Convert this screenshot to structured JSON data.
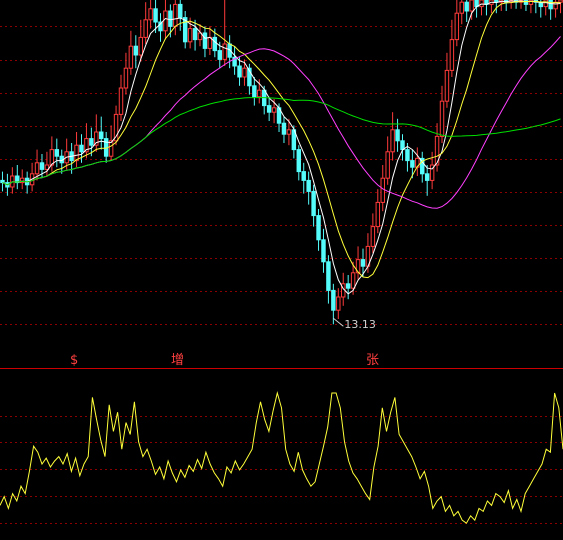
{
  "colors": {
    "background": "#000000",
    "grid": "#8b0000",
    "up_candle": "#ff3b3b",
    "down_candle": "#54fcfc",
    "ma_fast": "#ffffff",
    "ma_mid": "#ffff3a",
    "ma_slow": "#ff40ff",
    "ma_long": "#00e000",
    "indicator": "#ffff3a",
    "divider": "#cc0000",
    "markers": "#ff4040"
  },
  "main": {
    "low_price_label": "13.13",
    "markers": [
      {
        "key": "marker-1",
        "text": "$"
      },
      {
        "key": "marker-2",
        "text": "增"
      },
      {
        "key": "marker-3",
        "text": "张"
      }
    ]
  },
  "chart_data": [
    {
      "type": "candlestick",
      "title": "",
      "ylim": [
        12.5,
        20.5
      ],
      "annotations": [
        "13.13"
      ],
      "candles": [
        [
          16.4,
          16.35,
          16.6,
          16.15
        ],
        [
          16.35,
          16.25,
          16.55,
          16.05
        ],
        [
          16.25,
          16.5,
          16.7,
          16.1
        ],
        [
          16.5,
          16.35,
          16.75,
          16.2
        ],
        [
          16.35,
          16.45,
          16.65,
          16.2
        ],
        [
          16.45,
          16.3,
          16.6,
          16.1
        ],
        [
          16.3,
          16.55,
          16.8,
          16.15
        ],
        [
          16.55,
          16.8,
          17.1,
          16.4
        ],
        [
          16.8,
          16.65,
          17.0,
          16.45
        ],
        [
          16.65,
          16.75,
          17.05,
          16.5
        ],
        [
          16.75,
          17.1,
          17.4,
          16.6
        ],
        [
          17.1,
          16.95,
          17.35,
          16.7
        ],
        [
          16.95,
          16.8,
          17.1,
          16.55
        ],
        [
          16.8,
          17.05,
          17.35,
          16.65
        ],
        [
          17.05,
          16.85,
          17.25,
          16.55
        ],
        [
          16.85,
          17.2,
          17.5,
          16.7
        ],
        [
          17.2,
          17.05,
          17.45,
          16.8
        ],
        [
          17.05,
          17.35,
          17.7,
          16.9
        ],
        [
          17.35,
          17.2,
          17.6,
          16.95
        ],
        [
          17.2,
          17.5,
          17.9,
          17.05
        ],
        [
          17.5,
          17.35,
          17.85,
          17.1
        ],
        [
          17.35,
          16.95,
          17.5,
          16.8
        ],
        [
          16.95,
          17.3,
          17.65,
          16.85
        ],
        [
          17.3,
          17.9,
          18.1,
          17.2
        ],
        [
          17.9,
          18.5,
          18.8,
          17.75
        ],
        [
          18.5,
          18.95,
          19.3,
          18.35
        ],
        [
          18.95,
          19.45,
          19.8,
          18.8
        ],
        [
          19.45,
          19.25,
          19.7,
          18.95
        ],
        [
          19.25,
          19.65,
          20.05,
          19.1
        ],
        [
          19.65,
          20.05,
          20.45,
          19.5
        ],
        [
          20.05,
          20.3,
          20.55,
          19.85
        ],
        [
          20.3,
          20.0,
          20.55,
          19.75
        ],
        [
          20.0,
          19.8,
          20.2,
          19.55
        ],
        [
          19.8,
          20.25,
          20.55,
          19.6
        ],
        [
          20.25,
          19.9,
          20.4,
          19.65
        ],
        [
          19.9,
          20.4,
          20.55,
          19.7
        ],
        [
          20.4,
          20.1,
          20.55,
          19.8
        ],
        [
          20.1,
          19.55,
          20.25,
          19.4
        ],
        [
          19.55,
          19.85,
          20.1,
          19.4
        ],
        [
          19.85,
          19.6,
          20.05,
          19.35
        ],
        [
          19.6,
          19.75,
          19.95,
          19.45
        ],
        [
          19.75,
          19.4,
          19.9,
          19.2
        ],
        [
          19.4,
          19.65,
          19.9,
          19.25
        ],
        [
          19.65,
          19.35,
          19.85,
          19.2
        ],
        [
          19.35,
          19.15,
          19.55,
          18.95
        ],
        [
          19.15,
          19.5,
          20.5,
          19.0
        ],
        [
          19.5,
          19.2,
          19.7,
          18.95
        ],
        [
          19.2,
          19.0,
          19.45,
          18.8
        ],
        [
          19.0,
          18.75,
          19.2,
          18.55
        ],
        [
          18.75,
          18.95,
          19.15,
          18.55
        ],
        [
          18.95,
          18.55,
          19.05,
          18.35
        ],
        [
          18.55,
          18.3,
          18.75,
          18.1
        ],
        [
          18.3,
          18.45,
          18.7,
          18.15
        ],
        [
          18.45,
          18.1,
          18.55,
          17.9
        ],
        [
          18.1,
          17.95,
          18.3,
          17.75
        ],
        [
          17.95,
          18.05,
          18.25,
          17.7
        ],
        [
          18.05,
          17.7,
          18.15,
          17.5
        ],
        [
          17.7,
          17.45,
          17.85,
          17.25
        ],
        [
          17.45,
          17.55,
          17.8,
          17.2
        ],
        [
          17.55,
          17.1,
          17.65,
          16.9
        ],
        [
          17.1,
          16.6,
          17.2,
          16.4
        ],
        [
          16.6,
          16.4,
          16.8,
          16.1
        ],
        [
          16.4,
          16.15,
          16.6,
          15.85
        ],
        [
          16.15,
          15.6,
          16.3,
          15.35
        ],
        [
          15.6,
          15.05,
          15.75,
          14.8
        ],
        [
          15.05,
          14.55,
          15.3,
          14.3
        ],
        [
          14.55,
          13.9,
          14.7,
          13.6
        ],
        [
          13.9,
          13.45,
          14.05,
          13.13
        ],
        [
          13.45,
          13.75,
          13.95,
          13.25
        ],
        [
          13.75,
          14.05,
          14.3,
          13.55
        ],
        [
          14.05,
          13.95,
          14.25,
          13.7
        ],
        [
          13.95,
          14.3,
          14.55,
          13.8
        ],
        [
          14.3,
          14.6,
          14.9,
          14.15
        ],
        [
          14.6,
          14.45,
          14.85,
          14.2
        ],
        [
          14.45,
          14.9,
          15.2,
          14.3
        ],
        [
          14.9,
          15.35,
          15.65,
          14.75
        ],
        [
          15.35,
          15.9,
          16.2,
          15.2
        ],
        [
          15.9,
          16.45,
          16.75,
          15.7
        ],
        [
          16.45,
          17.05,
          17.4,
          16.3
        ],
        [
          17.05,
          17.55,
          17.95,
          16.85
        ],
        [
          17.55,
          17.3,
          17.8,
          17.05
        ],
        [
          17.3,
          17.1,
          17.45,
          16.85
        ],
        [
          17.1,
          16.85,
          17.25,
          16.6
        ],
        [
          16.85,
          16.7,
          17.1,
          16.45
        ],
        [
          16.7,
          16.9,
          17.15,
          16.5
        ],
        [
          16.9,
          16.55,
          17.05,
          16.35
        ],
        [
          16.55,
          16.4,
          16.75,
          16.05
        ],
        [
          16.4,
          16.75,
          17.05,
          16.2
        ],
        [
          16.75,
          17.4,
          17.7,
          16.6
        ],
        [
          17.4,
          18.2,
          18.55,
          17.25
        ],
        [
          18.2,
          18.9,
          19.3,
          18.05
        ],
        [
          18.9,
          19.6,
          20.05,
          18.75
        ],
        [
          19.6,
          20.2,
          20.55,
          19.45
        ],
        [
          20.2,
          20.45,
          20.55,
          19.95
        ],
        [
          20.45,
          20.25,
          20.55,
          20.0
        ],
        [
          20.25,
          20.5,
          20.55,
          20.05
        ],
        [
          20.5,
          20.35,
          20.55,
          20.1
        ],
        [
          20.35,
          20.5,
          20.55,
          20.15
        ],
        [
          20.5,
          20.4,
          20.55,
          20.15
        ],
        [
          20.4,
          20.5,
          20.55,
          20.2
        ],
        [
          20.5,
          20.45,
          20.55,
          20.2
        ],
        [
          20.45,
          20.5,
          20.55,
          20.25
        ],
        [
          20.5,
          20.45,
          20.55,
          20.25
        ],
        [
          20.45,
          20.5,
          20.55,
          20.3
        ],
        [
          20.5,
          20.45,
          20.55,
          20.3
        ],
        [
          20.45,
          20.5,
          20.55,
          20.3
        ],
        [
          20.5,
          20.4,
          20.55,
          20.25
        ],
        [
          20.4,
          20.5,
          20.55,
          20.2
        ],
        [
          20.5,
          20.45,
          20.55,
          20.2
        ],
        [
          20.45,
          20.35,
          20.55,
          20.1
        ],
        [
          20.35,
          20.5,
          20.55,
          20.15
        ],
        [
          20.5,
          20.3,
          20.55,
          20.05
        ],
        [
          20.3,
          20.45,
          20.55,
          20.1
        ],
        [
          20.45,
          20.5,
          20.55,
          20.2
        ]
      ],
      "moving_averages": [
        {
          "color_key": "ma_fast",
          "period": 5
        },
        {
          "color_key": "ma_mid",
          "period": 10
        },
        {
          "color_key": "ma_slow",
          "period": 30
        },
        {
          "color_key": "ma_long",
          "period": 60
        }
      ]
    },
    {
      "type": "line",
      "title": "",
      "ylim": [
        0,
        100
      ],
      "values": [
        22,
        28,
        20,
        30,
        25,
        35,
        30,
        45,
        62,
        58,
        50,
        54,
        48,
        52,
        55,
        50,
        57,
        45,
        54,
        42,
        50,
        55,
        95,
        80,
        66,
        55,
        90,
        72,
        85,
        60,
        78,
        70,
        92,
        65,
        55,
        60,
        52,
        43,
        48,
        40,
        52,
        44,
        38,
        46,
        41,
        49,
        45,
        53,
        47,
        58,
        50,
        44,
        40,
        35,
        48,
        44,
        52,
        46,
        50,
        55,
        60,
        78,
        92,
        80,
        72,
        86,
        98,
        88,
        60,
        50,
        45,
        58,
        46,
        40,
        35,
        38,
        50,
        62,
        75,
        98,
        98,
        88,
        65,
        52,
        44,
        40,
        35,
        30,
        26,
        48,
        62,
        88,
        72,
        85,
        95,
        70,
        65,
        60,
        55,
        48,
        40,
        45,
        35,
        20,
        25,
        28,
        18,
        22,
        15,
        18,
        12,
        10,
        15,
        12,
        20,
        18,
        25,
        22,
        30,
        28,
        24,
        32,
        20,
        26,
        18,
        30,
        35,
        40,
        45,
        50,
        60,
        58,
        98,
        88,
        60
      ]
    }
  ]
}
